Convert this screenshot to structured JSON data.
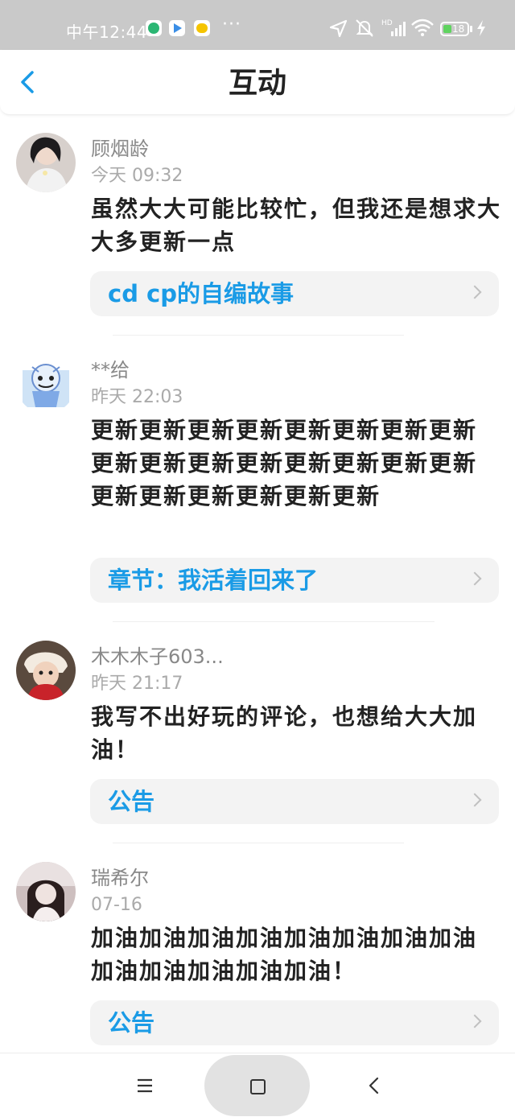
{
  "status_bar": {
    "time": "中午12:44",
    "dots": "···",
    "battery_level": "18"
  },
  "header": {
    "title": "互动"
  },
  "comments": [
    {
      "username": "顾烟龄",
      "time": "今天 09:32",
      "text": "虽然大大可能比较忙，但我还是想求大大多更新一点",
      "link": "cd cp的自编故事"
    },
    {
      "username": "**给",
      "time": "昨天 22:03",
      "text": "更新更新更新更新更新更新更新更新更新更新更新更新更新更新更新更新更新更新更新更新更新更新",
      "link": "章节：我活着回来了"
    },
    {
      "username": "木木木子603...",
      "time": "昨天 21:17",
      "text": "我写不出好玩的评论，也想给大大加油！",
      "link": "公告"
    },
    {
      "username": "瑞希尔",
      "time": "07-16",
      "text": "加油加油加油加油加油加油加油加油加油加油加油加油加油！",
      "link": "公告"
    }
  ],
  "colors": {
    "accent": "#1a9be6",
    "status_bar": "#c9c9c9",
    "card_bg": "#f3f3f3"
  },
  "icons": [
    "back-arrow-icon",
    "chevron-right-icon",
    "menu-icon",
    "home-icon",
    "back-icon",
    "wifi-icon",
    "signal-icon",
    "battery-icon",
    "location-icon",
    "mute-icon"
  ]
}
